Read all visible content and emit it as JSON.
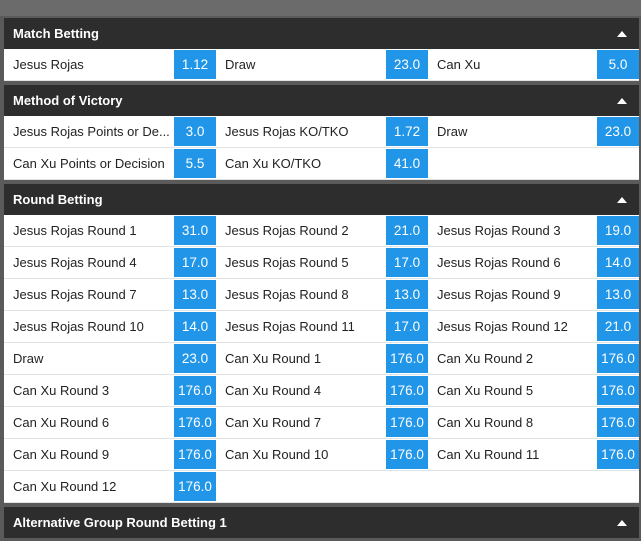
{
  "sections": [
    {
      "title": "Match Betting",
      "rows": [
        [
          {
            "name": "Jesus Rojas",
            "odds": "1.12"
          },
          {
            "name": "Draw",
            "odds": "23.0"
          },
          {
            "name": "Can Xu",
            "odds": "5.0"
          }
        ]
      ]
    },
    {
      "title": "Method of Victory",
      "rows": [
        [
          {
            "name": "Jesus Rojas Points or De...",
            "odds": "3.0"
          },
          {
            "name": "Jesus Rojas KO/TKO",
            "odds": "1.72"
          },
          {
            "name": "Draw",
            "odds": "23.0"
          }
        ],
        [
          {
            "name": "Can Xu Points or Decision",
            "odds": "5.5"
          },
          {
            "name": "Can Xu KO/TKO",
            "odds": "41.0"
          },
          null
        ]
      ]
    },
    {
      "title": "Round Betting",
      "rows": [
        [
          {
            "name": "Jesus Rojas Round 1",
            "odds": "31.0"
          },
          {
            "name": "Jesus Rojas Round 2",
            "odds": "21.0"
          },
          {
            "name": "Jesus Rojas Round 3",
            "odds": "19.0"
          }
        ],
        [
          {
            "name": "Jesus Rojas Round 4",
            "odds": "17.0"
          },
          {
            "name": "Jesus Rojas Round 5",
            "odds": "17.0"
          },
          {
            "name": "Jesus Rojas Round 6",
            "odds": "14.0"
          }
        ],
        [
          {
            "name": "Jesus Rojas Round 7",
            "odds": "13.0"
          },
          {
            "name": "Jesus Rojas Round 8",
            "odds": "13.0"
          },
          {
            "name": "Jesus Rojas Round 9",
            "odds": "13.0"
          }
        ],
        [
          {
            "name": "Jesus Rojas Round 10",
            "odds": "14.0"
          },
          {
            "name": "Jesus Rojas Round 11",
            "odds": "17.0"
          },
          {
            "name": "Jesus Rojas Round 12",
            "odds": "21.0"
          }
        ],
        [
          {
            "name": "Draw",
            "odds": "23.0"
          },
          {
            "name": "Can Xu Round 1",
            "odds": "176.0"
          },
          {
            "name": "Can Xu Round 2",
            "odds": "176.0"
          }
        ],
        [
          {
            "name": "Can Xu Round 3",
            "odds": "176.0"
          },
          {
            "name": "Can Xu Round 4",
            "odds": "176.0"
          },
          {
            "name": "Can Xu Round 5",
            "odds": "176.0"
          }
        ],
        [
          {
            "name": "Can Xu Round 6",
            "odds": "176.0"
          },
          {
            "name": "Can Xu Round 7",
            "odds": "176.0"
          },
          {
            "name": "Can Xu Round 8",
            "odds": "176.0"
          }
        ],
        [
          {
            "name": "Can Xu Round 9",
            "odds": "176.0"
          },
          {
            "name": "Can Xu Round 10",
            "odds": "176.0"
          },
          {
            "name": "Can Xu Round 11",
            "odds": "176.0"
          }
        ],
        [
          {
            "name": "Can Xu Round 12",
            "odds": "176.0"
          },
          null,
          null
        ]
      ]
    },
    {
      "title": "Alternative Group Round Betting 1",
      "rows": []
    }
  ],
  "icons": {
    "collapse": "chevron-up-icon"
  },
  "colors": {
    "header_bg": "#2d2d2d",
    "odds_bg": "#2196e8",
    "page_bg": "#5a5a5a"
  }
}
